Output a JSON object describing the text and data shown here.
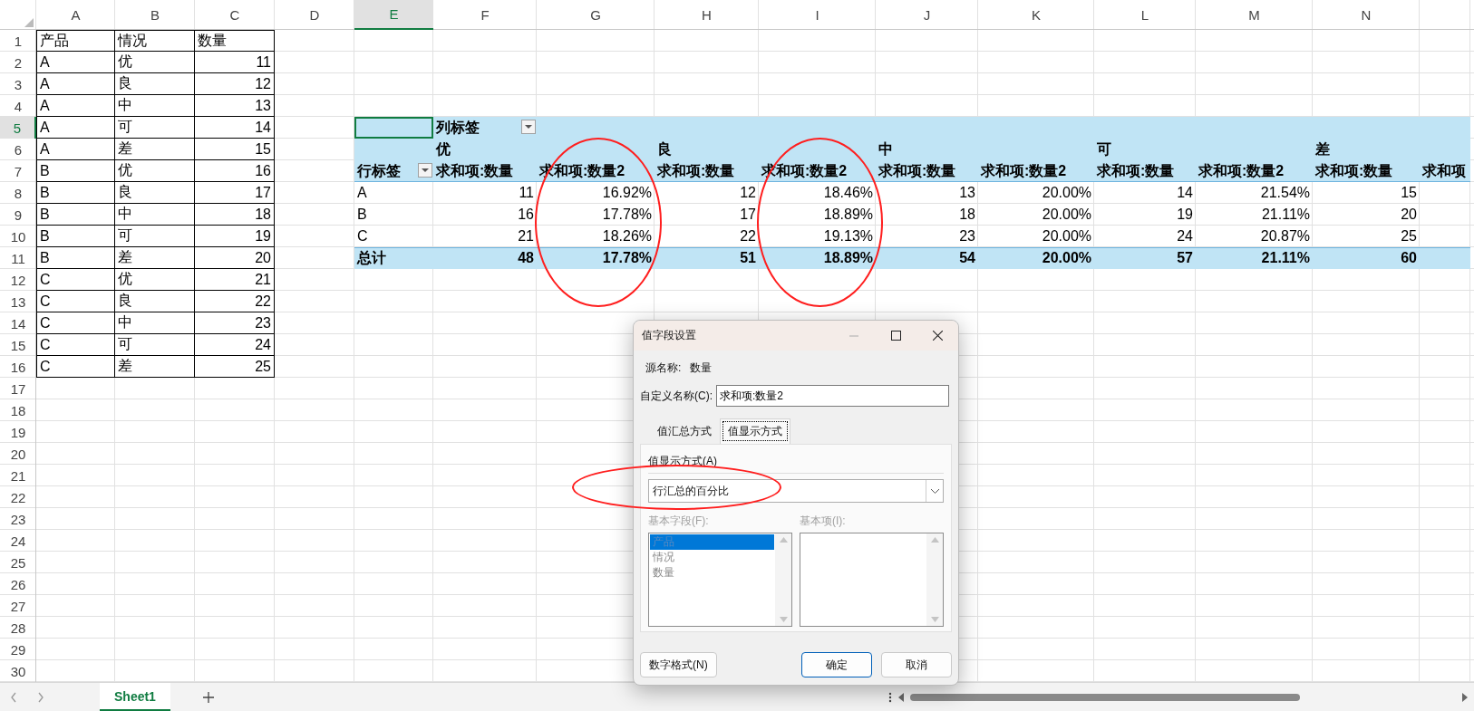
{
  "column_headers": [
    {
      "label": "A",
      "selected": false
    },
    {
      "label": "B",
      "selected": false
    },
    {
      "label": "C",
      "selected": false
    },
    {
      "label": "D",
      "selected": false
    },
    {
      "label": "E",
      "selected": true
    },
    {
      "label": "F",
      "selected": false
    },
    {
      "label": "G",
      "selected": false
    },
    {
      "label": "H",
      "selected": false
    },
    {
      "label": "I",
      "selected": false
    },
    {
      "label": "J",
      "selected": false
    },
    {
      "label": "K",
      "selected": false
    },
    {
      "label": "L",
      "selected": false
    },
    {
      "label": "M",
      "selected": false
    },
    {
      "label": "N",
      "selected": false
    }
  ],
  "row_headers": [
    {
      "label": "1",
      "selected": false
    },
    {
      "label": "2",
      "selected": false
    },
    {
      "label": "3",
      "selected": false
    },
    {
      "label": "4",
      "selected": false
    },
    {
      "label": "5",
      "selected": true
    },
    {
      "label": "6",
      "selected": false
    },
    {
      "label": "7",
      "selected": false
    },
    {
      "label": "8",
      "selected": false
    },
    {
      "label": "9",
      "selected": false
    },
    {
      "label": "10",
      "selected": false
    },
    {
      "label": "11",
      "selected": false
    },
    {
      "label": "12",
      "selected": false
    },
    {
      "label": "13",
      "selected": false
    },
    {
      "label": "14",
      "selected": false
    },
    {
      "label": "15",
      "selected": false
    },
    {
      "label": "16",
      "selected": false
    },
    {
      "label": "17",
      "selected": false
    },
    {
      "label": "18",
      "selected": false
    },
    {
      "label": "19",
      "selected": false
    },
    {
      "label": "20",
      "selected": false
    },
    {
      "label": "21",
      "selected": false
    },
    {
      "label": "22",
      "selected": false
    },
    {
      "label": "23",
      "selected": false
    },
    {
      "label": "24",
      "selected": false
    },
    {
      "label": "25",
      "selected": false
    },
    {
      "label": "26",
      "selected": false
    },
    {
      "label": "27",
      "selected": false
    },
    {
      "label": "28",
      "selected": false
    },
    {
      "label": "29",
      "selected": false
    },
    {
      "label": "30",
      "selected": false
    }
  ],
  "source_table": {
    "columns": [
      "产品",
      "情况",
      "数量"
    ],
    "rows": [
      [
        "A",
        "优",
        "11"
      ],
      [
        "A",
        "良",
        "12"
      ],
      [
        "A",
        "中",
        "13"
      ],
      [
        "A",
        "可",
        "14"
      ],
      [
        "A",
        "差",
        "15"
      ],
      [
        "B",
        "优",
        "16"
      ],
      [
        "B",
        "良",
        "17"
      ],
      [
        "B",
        "中",
        "18"
      ],
      [
        "B",
        "可",
        "19"
      ],
      [
        "B",
        "差",
        "20"
      ],
      [
        "C",
        "优",
        "21"
      ],
      [
        "C",
        "良",
        "22"
      ],
      [
        "C",
        "中",
        "23"
      ],
      [
        "C",
        "可",
        "24"
      ],
      [
        "C",
        "差",
        "25"
      ]
    ]
  },
  "pivot_table": {
    "corner_cell": {
      "selected": true
    },
    "column_label": "列标签",
    "row_label": "行标签",
    "groups": [
      {
        "label": "优",
        "measures": [
          {
            "label": "求和项:数量",
            "circled": false
          },
          {
            "label": "求和项:数量2",
            "circled": true
          }
        ]
      },
      {
        "label": "良",
        "measures": [
          {
            "label": "求和项:数量",
            "circled": false
          },
          {
            "label": "求和项:数量2",
            "circled": true
          }
        ]
      },
      {
        "label": "中",
        "measures": [
          {
            "label": "求和项:数量",
            "circled": false
          },
          {
            "label": "求和项:数量2",
            "circled": false
          }
        ]
      },
      {
        "label": "可",
        "measures": [
          {
            "label": "求和项:数量",
            "circled": false
          },
          {
            "label": "求和项:数量2",
            "circled": false
          }
        ]
      },
      {
        "label": "差",
        "measures": [
          {
            "label": "求和项:数量",
            "circled": false
          },
          {
            "label": "求和项",
            "circled": false
          }
        ]
      }
    ],
    "rows": [
      {
        "label": "A",
        "values": [
          "11",
          "16.92%",
          "12",
          "18.46%",
          "13",
          "20.00%",
          "14",
          "21.54%",
          "15"
        ]
      },
      {
        "label": "B",
        "values": [
          "16",
          "17.78%",
          "17",
          "18.89%",
          "18",
          "20.00%",
          "19",
          "21.11%",
          "20"
        ]
      },
      {
        "label": "C",
        "values": [
          "21",
          "18.26%",
          "22",
          "19.13%",
          "23",
          "20.00%",
          "24",
          "20.87%",
          "25"
        ]
      }
    ],
    "total": {
      "label": "总计",
      "values": [
        "48",
        "17.78%",
        "51",
        "18.89%",
        "54",
        "20.00%",
        "57",
        "21.11%",
        "60"
      ]
    }
  },
  "dialog": {
    "title": "值字段设置",
    "source_label": "源名称:",
    "source_value": "数量",
    "custom_name_label": "自定义名称(C):",
    "custom_name_value": "求和项:数量2",
    "tabs": [
      {
        "label": "值汇总方式",
        "selected": false
      },
      {
        "label": "值显示方式",
        "selected": true
      }
    ],
    "show_as_label": "值显示方式(A)",
    "show_as_value": "行汇总的百分比",
    "show_as_circled": true,
    "base_field_label": "基本字段(F):",
    "base_item_label": "基本项(I):",
    "disabled": true,
    "base_fields": [
      {
        "label": "产品",
        "selected": true
      },
      {
        "label": "情况",
        "selected": false
      },
      {
        "label": "数量",
        "selected": false
      }
    ],
    "buttons": [
      {
        "label": "数字格式(N)",
        "default": false
      },
      {
        "label": "确定",
        "default": true
      },
      {
        "label": "取消",
        "default": false
      }
    ]
  },
  "sheet_tabs": [
    {
      "label": "Sheet1",
      "selected": true
    }
  ]
}
